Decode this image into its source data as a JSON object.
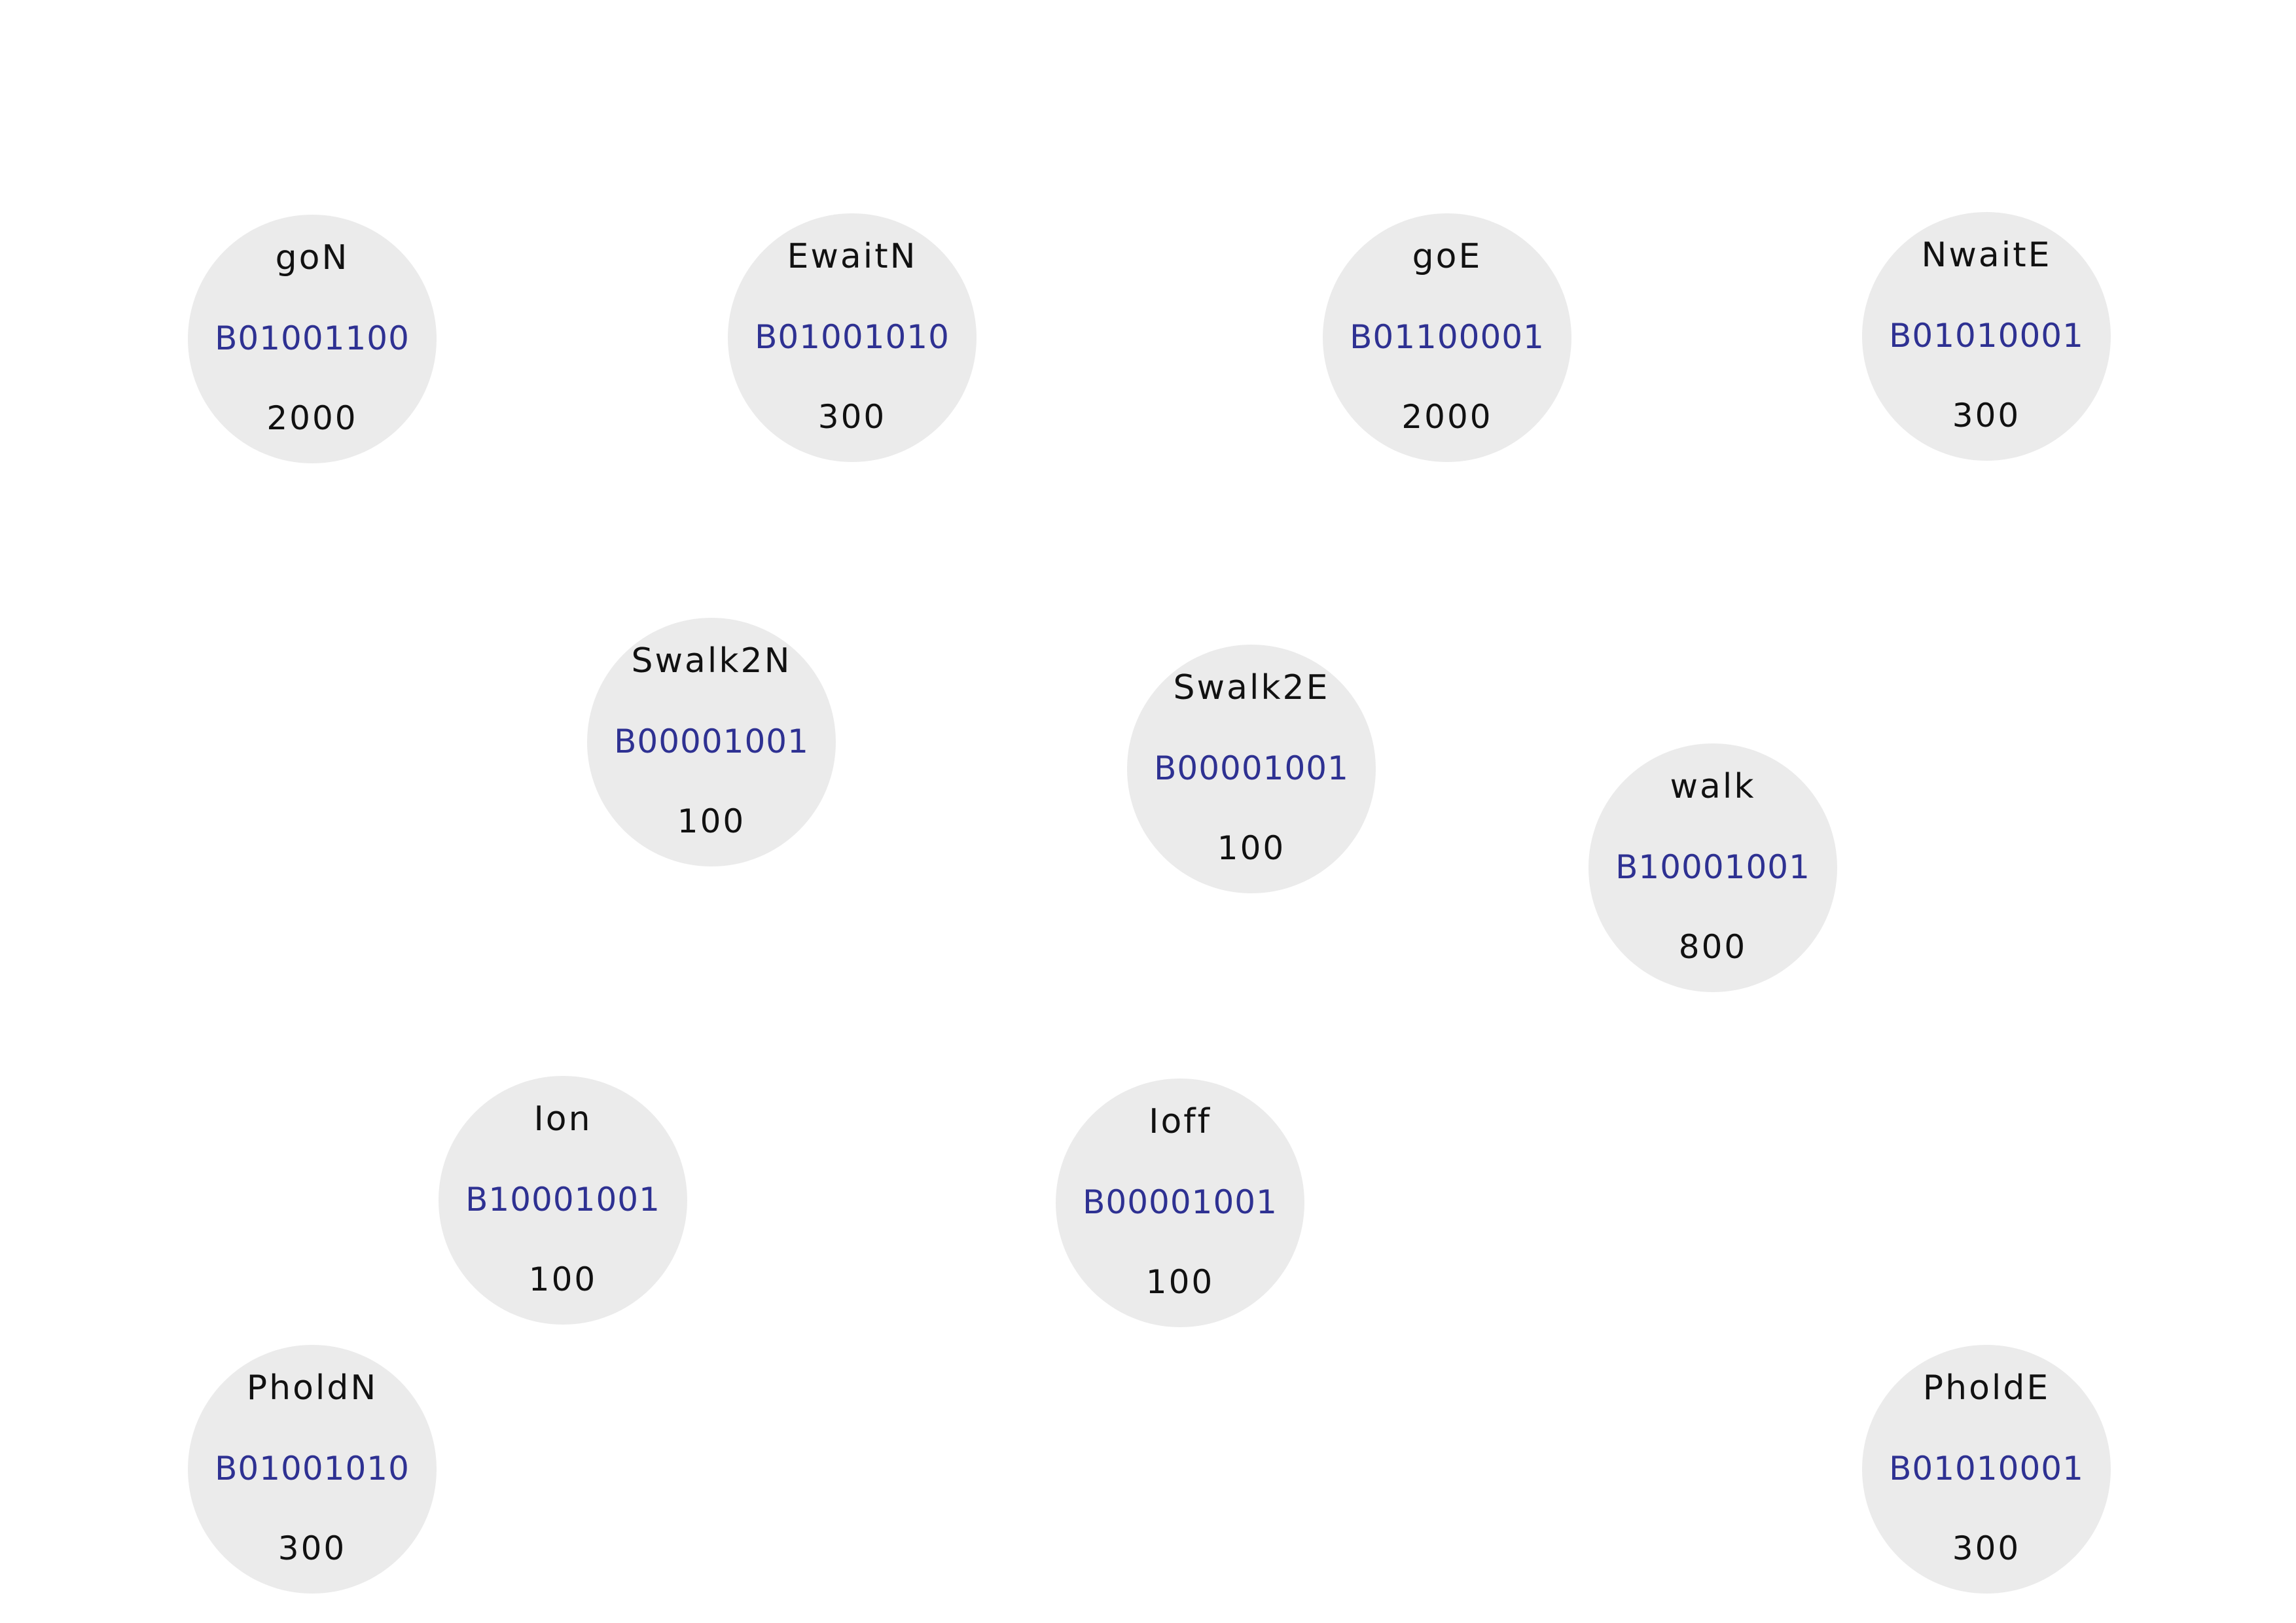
{
  "states": [
    {
      "name": "goN",
      "code": "B01001100",
      "duration": "2000"
    },
    {
      "name": "EwaitN",
      "code": "B01001010",
      "duration": "300"
    },
    {
      "name": "goE",
      "code": "B01100001",
      "duration": "2000"
    },
    {
      "name": "NwaitE",
      "code": "B01010001",
      "duration": "300"
    },
    {
      "name": "Swalk2N",
      "code": "B00001001",
      "duration": "100"
    },
    {
      "name": "Swalk2E",
      "code": "B00001001",
      "duration": "100"
    },
    {
      "name": "walk",
      "code": "B10001001",
      "duration": "800"
    },
    {
      "name": "Ion",
      "code": "B10001001",
      "duration": "100"
    },
    {
      "name": "Ioff",
      "code": "B00001001",
      "duration": "100"
    },
    {
      "name": "PholdN",
      "code": "B01001010",
      "duration": "300"
    },
    {
      "name": "PholdE",
      "code": "B01010001",
      "duration": "300"
    }
  ],
  "colors": {
    "node_fill": "#ebebeb",
    "code_text": "#2e3192",
    "label_text": "#111111",
    "background": "#ffffff"
  }
}
